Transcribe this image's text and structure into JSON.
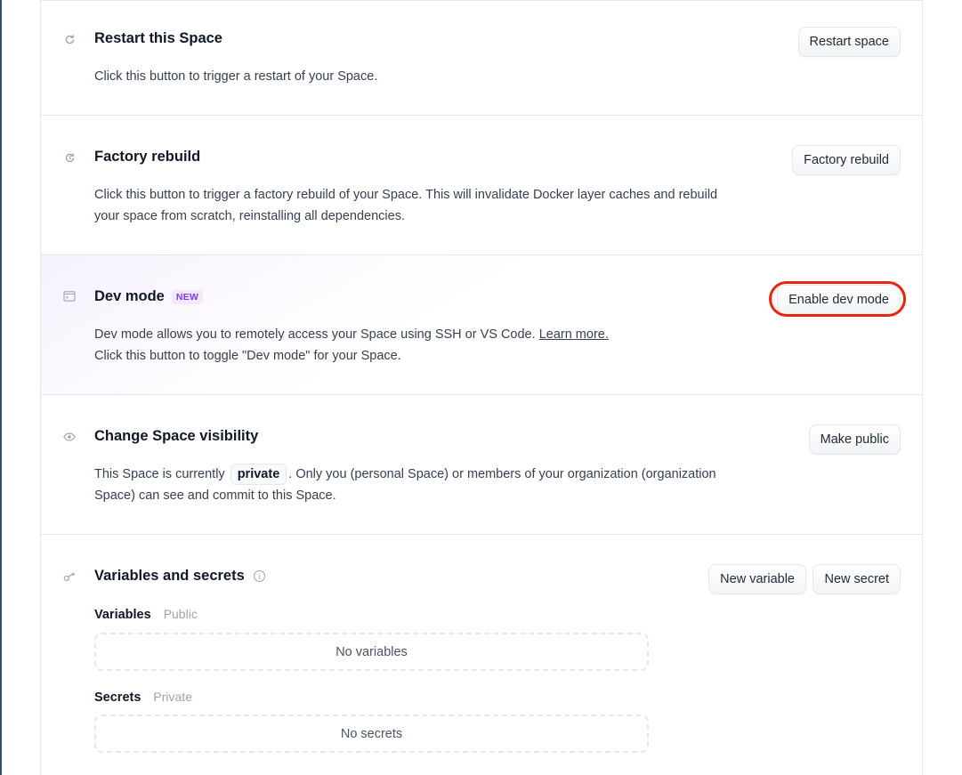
{
  "sections": {
    "restart": {
      "icon": "restart-icon",
      "title": "Restart this Space",
      "description": "Click this button to trigger a restart of your Space.",
      "button_label": "Restart space"
    },
    "factory": {
      "icon": "factory-rebuild-icon",
      "title": "Factory rebuild",
      "description": "Click this button to trigger a factory rebuild of your Space. This will invalidate Docker layer caches and rebuild your space from scratch, reinstalling all dependencies.",
      "button_label": "Factory rebuild"
    },
    "devmode": {
      "icon": "terminal-window-icon",
      "title": "Dev mode",
      "badge": "NEW",
      "description_part1": "Dev mode allows you to remotely access your Space using SSH or VS Code.",
      "learn_more": "Learn more.",
      "description_part2": "Click this button to toggle \"Dev mode\" for your Space.",
      "button_label": "Enable dev mode"
    },
    "visibility": {
      "icon": "eye-icon",
      "title": "Change Space visibility",
      "description_part1": "This Space is currently",
      "status": "private",
      "description_part2": ". Only you (personal Space) or members of your organization (organization Space) can see and commit to this Space.",
      "button_label": "Make public"
    },
    "variables": {
      "icon": "key-icon",
      "title": "Variables and secrets",
      "info_icon": "info-icon",
      "new_variable_label": "New variable",
      "new_secret_label": "New secret",
      "variables_label": "Variables",
      "variables_sub": "Public",
      "variables_empty": "No variables",
      "secrets_label": "Secrets",
      "secrets_sub": "Private",
      "secrets_empty": "No secrets"
    }
  },
  "colors": {
    "highlight": "#e8250f",
    "badge_text": "#7c3aed",
    "badge_bg": "#f3e8ff"
  }
}
